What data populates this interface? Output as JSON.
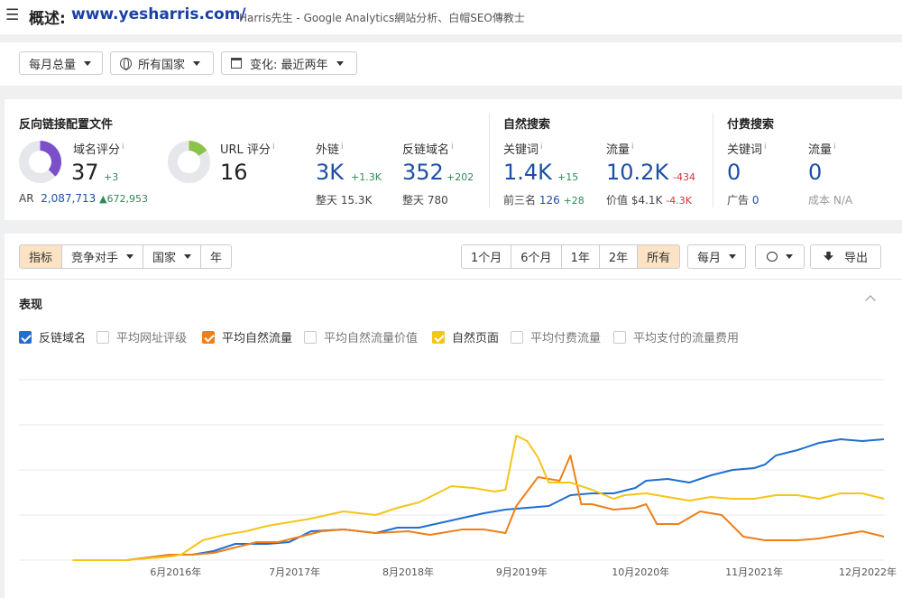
{
  "header": {
    "title_prefix": "概述:",
    "domain": "www.yesharris.com/",
    "subtitle": "Harris先生 - Google Analytics網站分析、白帽SEO傳教士"
  },
  "filters": {
    "volume": "每月总量",
    "country": "所有国家",
    "change": "变化: 最近两年"
  },
  "backlinks": {
    "title": "反向链接配置文件",
    "dr_label": "域名评分",
    "dr_value": "37",
    "dr_delta": "+3",
    "ur_label": "URL 评分",
    "ur_value": "16",
    "ar_label": "AR",
    "ar_value": "2,087,713",
    "ar_delta": "▲672,953",
    "ext_label": "外链",
    "ext_value": "3K",
    "ext_delta": "+1.3K",
    "ext_sub_label": "整天",
    "ext_sub_value": "15.3K",
    "rd_label": "反链域名",
    "rd_value": "352",
    "rd_delta": "+202",
    "rd_sub_label": "整天",
    "rd_sub_value": "780"
  },
  "organic": {
    "title": "自然搜索",
    "kw_label": "关键词",
    "kw_value": "1.4K",
    "kw_delta": "+15",
    "top3_label": "前三名",
    "top3_value": "126",
    "top3_delta": "+28",
    "traffic_label": "流量",
    "traffic_value": "10.2K",
    "traffic_delta": "-434",
    "value_label": "价值",
    "value_value": "$4.1K",
    "value_delta": "-4.3K"
  },
  "paid": {
    "title": "付费搜索",
    "kw_label": "关键词",
    "kw_value": "0",
    "ads_label": "广告",
    "ads_value": "0",
    "traffic_label": "流量",
    "traffic_value": "0",
    "cost_label": "成本",
    "cost_value": "N/A"
  },
  "toolbar": {
    "left_tabs": [
      "指标",
      "竞争对手",
      "国家",
      "年"
    ],
    "range_tabs": [
      "1个月",
      "6个月",
      "1年",
      "2年",
      "所有"
    ],
    "period": "每月",
    "export": "导出"
  },
  "chart_section": {
    "title": "表现",
    "legend": [
      {
        "label": "反链域名",
        "checked": true,
        "color": "#1f6fd1"
      },
      {
        "label": "平均网址评级",
        "checked": false,
        "color": ""
      },
      {
        "label": "平均自然流量",
        "checked": true,
        "color": "#f07f1a"
      },
      {
        "label": "平均自然流量价值",
        "checked": false,
        "color": ""
      },
      {
        "label": "自然页面",
        "checked": true,
        "color": "#f5c518"
      },
      {
        "label": "平均付费流量",
        "checked": false,
        "color": ""
      },
      {
        "label": "平均支付的流量费用",
        "checked": false,
        "color": ""
      }
    ]
  },
  "chart_data": {
    "type": "line",
    "x_ticks": [
      "6月2016年",
      "7月2017年",
      "8月2018年",
      "9月2019年",
      "10月2020年",
      "11月2021年",
      "12月2022年"
    ],
    "x_range": [
      2015.0,
      2023.0
    ],
    "y_range": [
      0,
      100
    ],
    "grid": true,
    "series": [
      {
        "name": "反链域名",
        "color": "#1f6fd1",
        "x": [
          2015.5,
          2016.0,
          2016.4,
          2016.6,
          2016.8,
          2017.0,
          2017.1,
          2017.3,
          2017.5,
          2017.7,
          2018.0,
          2018.3,
          2018.5,
          2018.7,
          2019.0,
          2019.3,
          2019.5,
          2019.7,
          2019.9,
          2020.1,
          2020.3,
          2020.5,
          2020.7,
          2020.8,
          2021.0,
          2021.2,
          2021.4,
          2021.6,
          2021.8,
          2021.9,
          2022.0,
          2022.2,
          2022.4,
          2022.6,
          2022.8,
          2023.0
        ],
        "y": [
          0,
          0,
          3,
          3,
          5,
          9,
          9,
          9,
          10,
          16,
          17,
          15,
          18,
          18,
          22,
          26,
          28,
          29,
          30,
          36,
          37,
          37,
          40,
          44,
          45,
          43,
          47,
          50,
          51,
          53,
          58,
          61,
          65,
          67,
          66,
          67
        ]
      },
      {
        "name": "平均自然流量",
        "color": "#f07f1a",
        "x": [
          2015.5,
          2016.0,
          2016.4,
          2016.6,
          2016.8,
          2017.0,
          2017.2,
          2017.4,
          2017.6,
          2017.8,
          2018.0,
          2018.3,
          2018.6,
          2018.8,
          2019.1,
          2019.3,
          2019.4,
          2019.5,
          2019.6,
          2019.8,
          2019.9,
          2020.0,
          2020.1,
          2020.2,
          2020.3,
          2020.5,
          2020.7,
          2020.8,
          2020.9,
          2021.1,
          2021.3,
          2021.5,
          2021.7,
          2021.9,
          2022.0,
          2022.2,
          2022.4,
          2022.6,
          2022.8,
          2023.0
        ],
        "y": [
          0,
          0,
          3,
          3,
          4,
          7,
          10,
          10,
          13,
          16,
          17,
          15,
          16,
          14,
          17,
          17,
          16,
          15,
          30,
          46,
          45,
          44,
          58,
          31,
          31,
          28,
          29,
          31,
          20,
          20,
          27,
          25,
          13,
          11,
          11,
          11,
          12,
          14,
          16,
          13
        ]
      },
      {
        "name": "自然页面",
        "color": "#f5c518",
        "x": [
          2015.5,
          2016.0,
          2016.4,
          2016.5,
          2016.7,
          2016.9,
          2017.1,
          2017.3,
          2017.5,
          2017.7,
          2018.0,
          2018.3,
          2018.5,
          2018.7,
          2019.0,
          2019.2,
          2019.4,
          2019.5,
          2019.6,
          2019.7,
          2019.8,
          2019.9,
          2020.1,
          2020.3,
          2020.5,
          2020.6,
          2020.8,
          2021.0,
          2021.2,
          2021.4,
          2021.6,
          2021.8,
          2022.0,
          2022.2,
          2022.4,
          2022.6,
          2022.8,
          2023.0
        ],
        "y": [
          0,
          0,
          2,
          3,
          11,
          14,
          16,
          19,
          21,
          23,
          27,
          25,
          29,
          32,
          41,
          40,
          38,
          39,
          69,
          66,
          57,
          43,
          43,
          39,
          34,
          36,
          37,
          35,
          33,
          35,
          34,
          34,
          36,
          36,
          34,
          37,
          37,
          34
        ]
      }
    ]
  }
}
